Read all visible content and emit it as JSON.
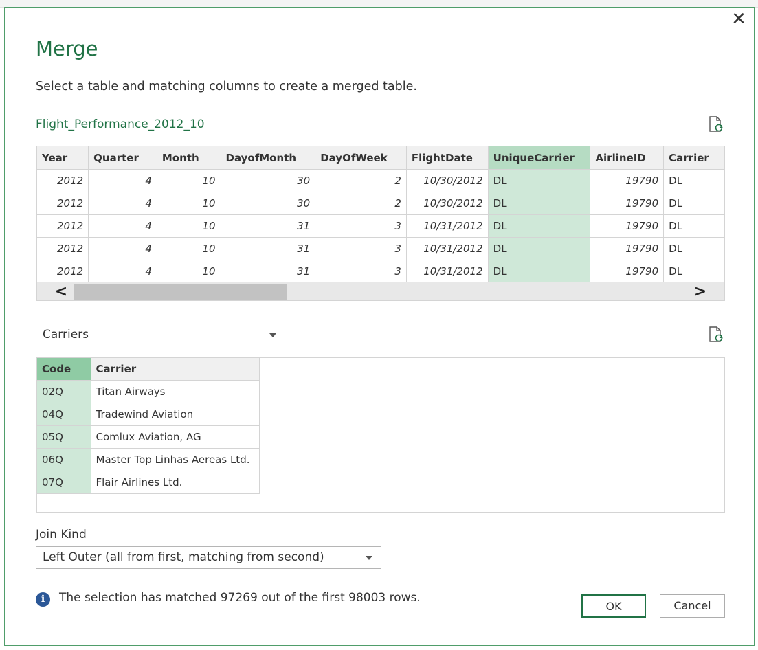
{
  "dialog": {
    "title": "Merge",
    "subtitle": "Select a table and matching columns to create a merged table.",
    "close_label": "✕"
  },
  "first_table": {
    "name": "Flight_Performance_2012_10",
    "columns": [
      "Year",
      "Quarter",
      "Month",
      "DayofMonth",
      "DayOfWeek",
      "FlightDate",
      "UniqueCarrier",
      "AirlineID",
      "Carrier"
    ],
    "selected_column": "UniqueCarrier",
    "rows": [
      [
        "2012",
        "4",
        "10",
        "30",
        "2",
        "10/30/2012",
        "DL",
        "19790",
        "DL"
      ],
      [
        "2012",
        "4",
        "10",
        "30",
        "2",
        "10/30/2012",
        "DL",
        "19790",
        "DL"
      ],
      [
        "2012",
        "4",
        "10",
        "31",
        "3",
        "10/31/2012",
        "DL",
        "19790",
        "DL"
      ],
      [
        "2012",
        "4",
        "10",
        "31",
        "3",
        "10/31/2012",
        "DL",
        "19790",
        "DL"
      ],
      [
        "2012",
        "4",
        "10",
        "31",
        "3",
        "10/31/2012",
        "DL",
        "19790",
        "DL"
      ]
    ],
    "scroll_left": "<",
    "scroll_right": ">"
  },
  "second_table": {
    "selected": "Carriers",
    "columns": [
      "Code",
      "Carrier"
    ],
    "selected_column": "Code",
    "rows": [
      [
        "02Q",
        "Titan Airways"
      ],
      [
        "04Q",
        "Tradewind Aviation"
      ],
      [
        "05Q",
        "Comlux Aviation, AG"
      ],
      [
        "06Q",
        "Master Top Linhas Aereas Ltd."
      ],
      [
        "07Q",
        "Flair Airlines Ltd."
      ]
    ]
  },
  "join": {
    "label": "Join Kind",
    "selected": "Left Outer (all from first, matching from second)"
  },
  "status": {
    "icon": "i",
    "text": "The selection has matched 97269 out of the first 98003 rows."
  },
  "buttons": {
    "ok": "OK",
    "cancel": "Cancel"
  },
  "colors": {
    "accent": "#217346",
    "selected_column": "#cfe8d8",
    "info": "#2b5797"
  }
}
